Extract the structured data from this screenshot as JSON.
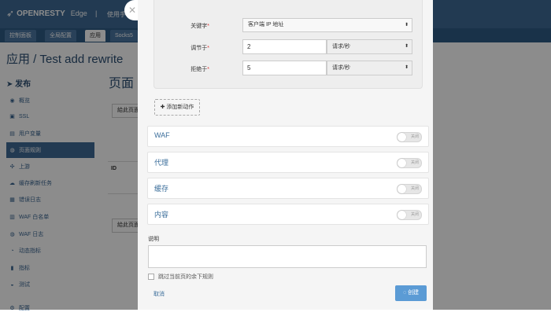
{
  "app": {
    "logo": "OPENRESTY",
    "product": "Edge",
    "user_text": "使用手",
    "tabs": [
      "控制面板",
      "全局配置",
      "应用",
      "Socks5"
    ],
    "active_tab": "应用",
    "title": "应用 / Test add rewrite",
    "page_title": "页面",
    "ghost_button_1": "給此页面",
    "ghost_button_2": "給此页面",
    "table_header": "ID"
  },
  "sidebar": {
    "header": "发布",
    "items": [
      {
        "label": "概览",
        "icon": "dashboard-icon"
      },
      {
        "label": "SSL",
        "icon": "lock-icon"
      },
      {
        "label": "用户变量",
        "icon": "variable-icon"
      },
      {
        "label": "页面规则",
        "icon": "globe-icon",
        "active": true
      },
      {
        "label": "上游",
        "icon": "upstream-icon"
      },
      {
        "label": "缓存刷新任务",
        "icon": "cloud-icon"
      },
      {
        "label": "错误日志",
        "icon": "log-icon"
      },
      {
        "label": "WAF 白名单",
        "icon": "list-icon"
      },
      {
        "label": "WAF 日志",
        "icon": "globe-icon"
      },
      {
        "label": "动态指标",
        "icon": "chart-icon"
      },
      {
        "label": "指标",
        "icon": "chart-icon"
      },
      {
        "label": "测试",
        "icon": "test-icon"
      },
      {
        "label": "配置",
        "icon": "gear-icon"
      }
    ]
  },
  "form": {
    "keyword_label": "关键字",
    "keyword_value": "客户端 IP 地址",
    "throttle_label": "调节于",
    "throttle_value": "2",
    "throttle_unit": "请求/秒",
    "reject_label": "拒绝于",
    "reject_value": "5",
    "reject_unit": "请求/秒",
    "add_action": "添加新动作",
    "sections": [
      {
        "title": "WAF",
        "toggle": "关闭"
      },
      {
        "title": "代理",
        "toggle": "关闭"
      },
      {
        "title": "缓存",
        "toggle": "关闭"
      },
      {
        "title": "内容",
        "toggle": "关闭"
      }
    ],
    "description_label": "说明",
    "skip_label": "跳过当前页的余下规则",
    "cancel": "取消",
    "create": "创建"
  }
}
